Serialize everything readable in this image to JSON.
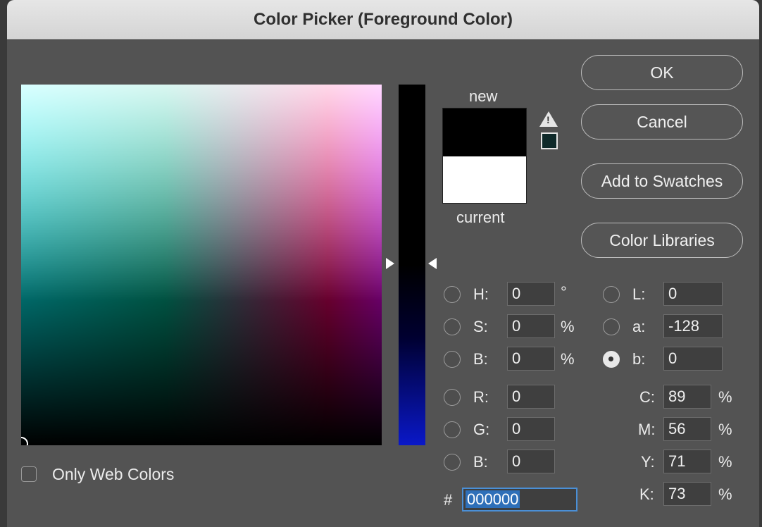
{
  "title": "Color Picker (Foreground Color)",
  "buttons": {
    "ok": "OK",
    "cancel": "Cancel",
    "add_swatches": "Add to Swatches",
    "color_libraries": "Color Libraries"
  },
  "swatch": {
    "new_label": "new",
    "current_label": "current",
    "new_color": "#000000",
    "current_color": "#ffffff"
  },
  "icons": {
    "gamut_warning": "warning-triangle-icon",
    "web_safe_swatch_color": "#0f2a2a"
  },
  "fields": {
    "H": {
      "label": "H:",
      "value": "0",
      "unit": "°"
    },
    "S": {
      "label": "S:",
      "value": "0",
      "unit": "%"
    },
    "Bri": {
      "label": "B:",
      "value": "0",
      "unit": "%"
    },
    "R": {
      "label": "R:",
      "value": "0"
    },
    "G": {
      "label": "G:",
      "value": "0"
    },
    "Blue": {
      "label": "B:",
      "value": "0"
    },
    "L": {
      "label": "L:",
      "value": "0"
    },
    "a": {
      "label": "a:",
      "value": "-128"
    },
    "b": {
      "label": "b:",
      "value": "0"
    },
    "C": {
      "label": "C:",
      "value": "89",
      "unit": "%"
    },
    "M": {
      "label": "M:",
      "value": "56",
      "unit": "%"
    },
    "Y": {
      "label": "Y:",
      "value": "71",
      "unit": "%"
    },
    "K": {
      "label": "K:",
      "value": "73",
      "unit": "%"
    }
  },
  "selected_radio": "b",
  "hex": {
    "prefix": "#",
    "value": "000000"
  },
  "only_web_colors": {
    "label": "Only Web Colors",
    "checked": false
  }
}
